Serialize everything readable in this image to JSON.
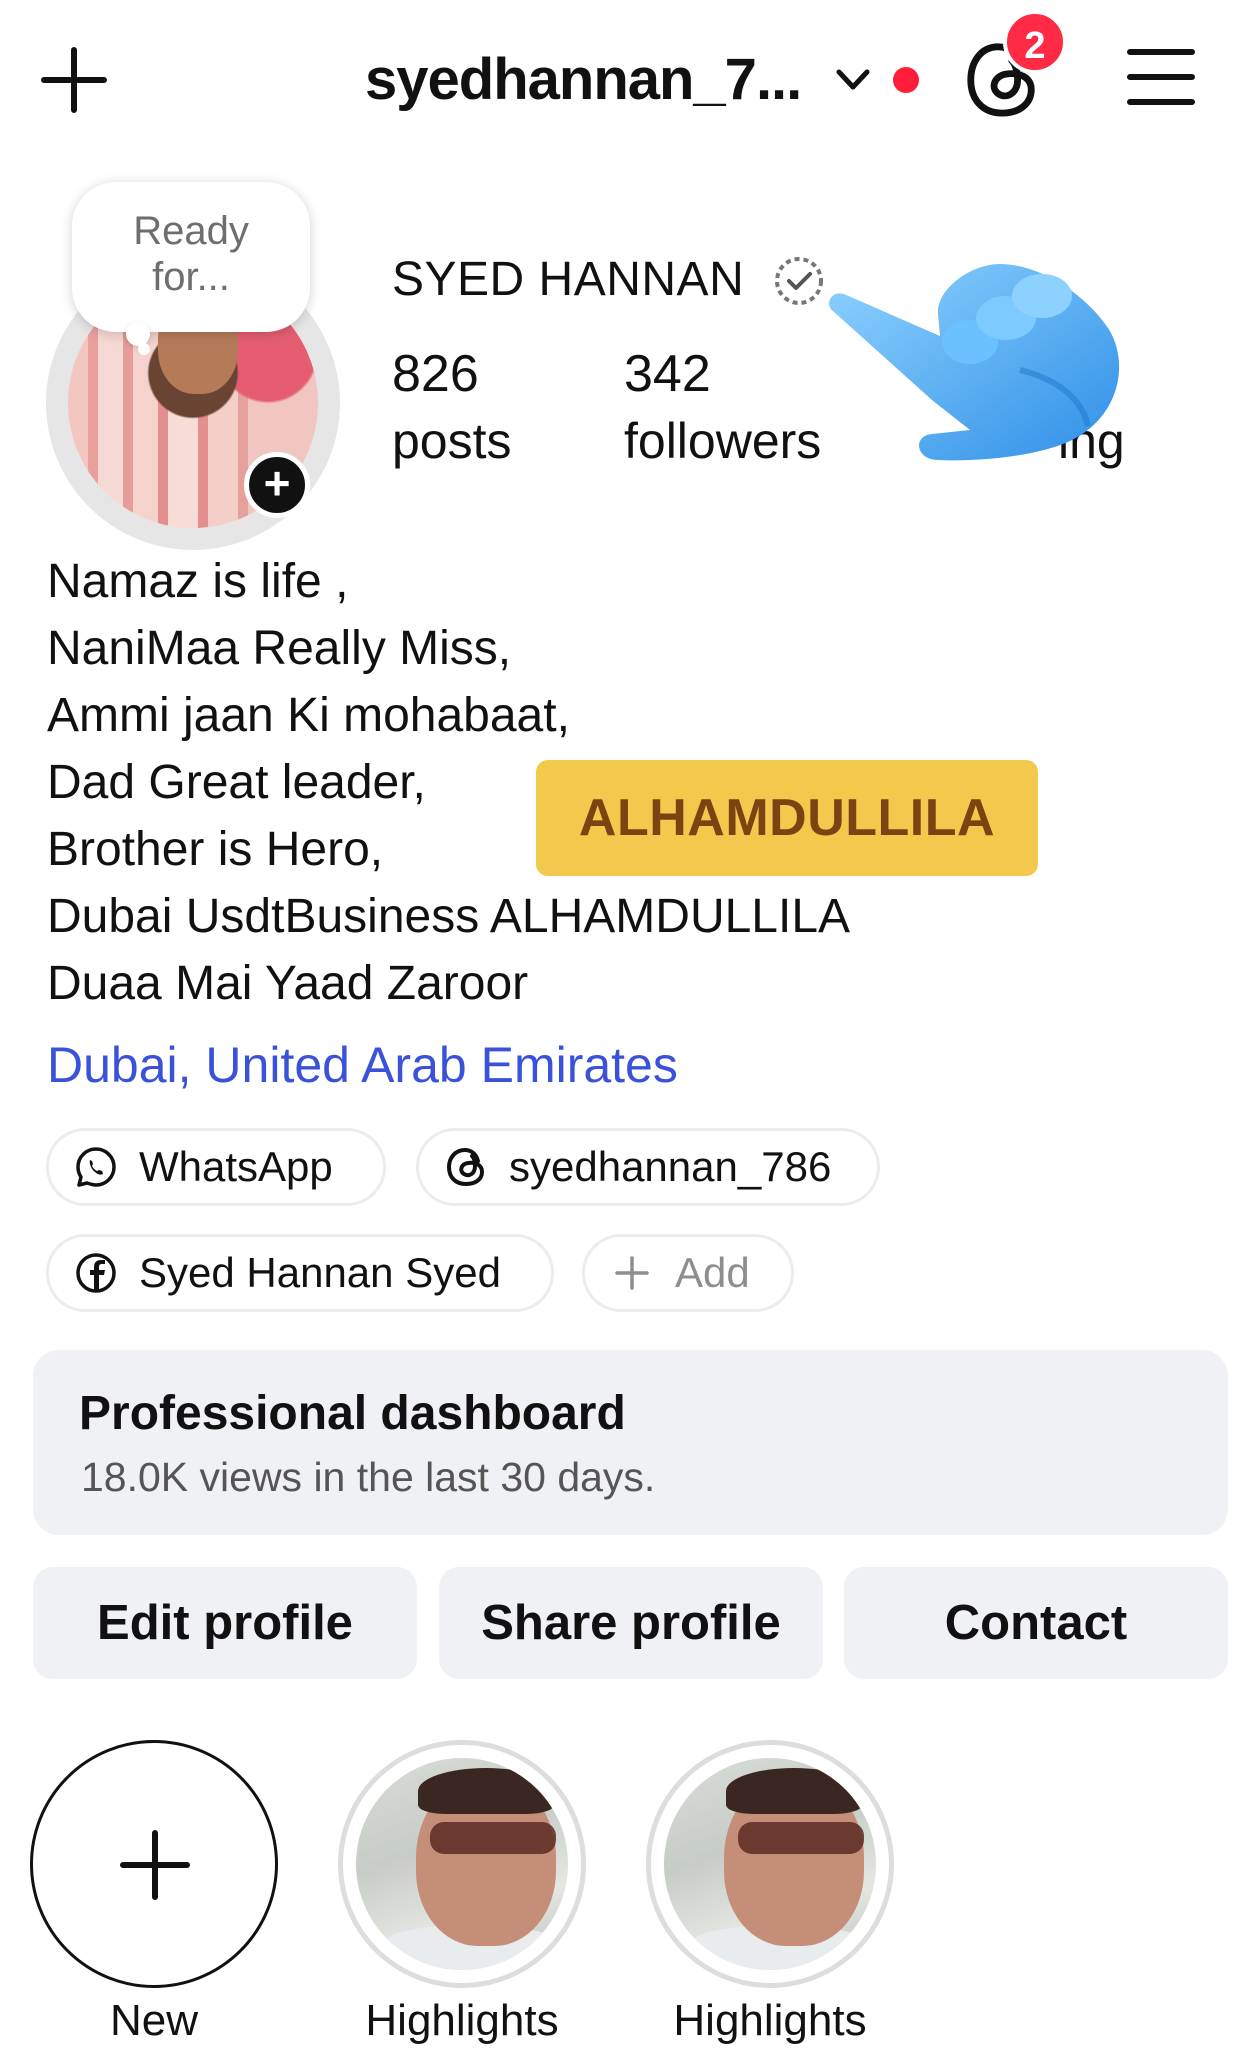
{
  "topbar": {
    "username": "syedhannan_7...",
    "notification_count": "2"
  },
  "profile": {
    "note_line1": "Ready",
    "note_line2": "for...",
    "display_name": "SYED HANNAN",
    "posts_count": "826",
    "posts_label": "posts",
    "followers_count": "342",
    "followers_label": "followers",
    "following_label_visible": "ing"
  },
  "bio": {
    "lines": [
      "Namaz is life ,",
      "NaniMaa Really Miss,",
      "Ammi jaan Ki mohabaat,",
      "Dad Great leader,",
      "Brother is Hero,",
      "Dubai UsdtBusiness ALHAMDULLILA",
      "Duaa Mai Yaad Zaroor"
    ],
    "badge_text": "ALHAMDULLILA",
    "location": "Dubai, United Arab Emirates"
  },
  "links": {
    "whatsapp": "WhatsApp",
    "threads": "syedhannan_786",
    "facebook": "Syed Hannan Syed",
    "add": "Add"
  },
  "dashboard": {
    "title": "Professional dashboard",
    "subtitle": "18.0K views in the last 30 days."
  },
  "actions": {
    "edit": "Edit profile",
    "share": "Share profile",
    "contact": "Contact"
  },
  "highlights": {
    "new_label": "New",
    "items": [
      "Highlights",
      "Highlights"
    ]
  },
  "colors": {
    "location_link": "#3a52d9",
    "badge_bg": "#f2c94c",
    "badge_text": "#7a4312",
    "notification_red": "#ff2a45"
  }
}
